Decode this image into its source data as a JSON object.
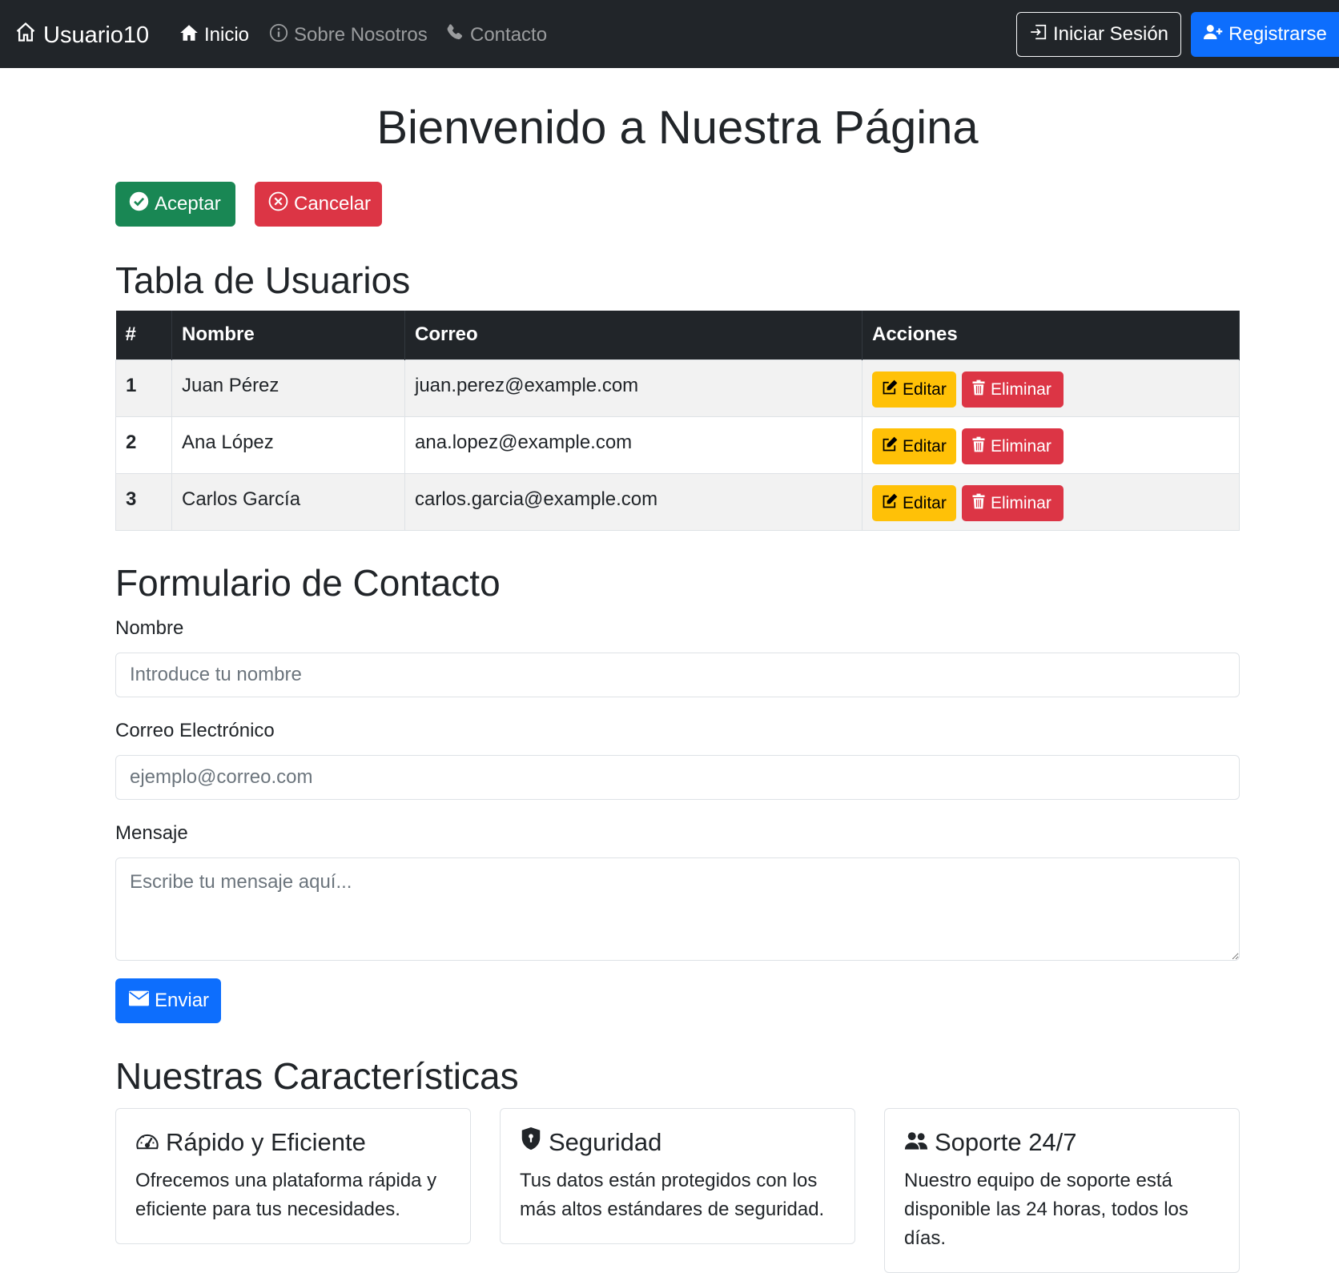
{
  "navbar": {
    "brand": "Usuario10",
    "links": [
      {
        "label": "Inicio",
        "icon": "house-fill-icon"
      },
      {
        "label": "Sobre Nosotros",
        "icon": "info-circle-icon"
      },
      {
        "label": "Contacto",
        "icon": "telephone-fill-icon"
      }
    ],
    "login_label": "Iniciar Sesión",
    "register_label": "Registrarse"
  },
  "page": {
    "title": "Bienvenido a Nuestra Página",
    "accept_label": "Aceptar",
    "cancel_label": "Cancelar"
  },
  "users": {
    "title": "Tabla de Usuarios",
    "headers": [
      "#",
      "Nombre",
      "Correo",
      "Acciones"
    ],
    "rows": [
      {
        "id": "1",
        "name": "Juan Pérez",
        "email": "juan.perez@example.com"
      },
      {
        "id": "2",
        "name": "Ana López",
        "email": "ana.lopez@example.com"
      },
      {
        "id": "3",
        "name": "Carlos García",
        "email": "carlos.garcia@example.com"
      }
    ],
    "edit_label": "Editar",
    "delete_label": "Eliminar"
  },
  "form": {
    "title": "Formulario de Contacto",
    "name_label": "Nombre",
    "name_placeholder": "Introduce tu nombre",
    "email_label": "Correo Electrónico",
    "email_placeholder": "ejemplo@correo.com",
    "message_label": "Mensaje",
    "message_placeholder": "Escribe tu mensaje aquí...",
    "send_label": "Enviar"
  },
  "features": {
    "title": "Nuestras Características",
    "cards": [
      {
        "title": "Rápido y Eficiente",
        "icon": "speedometer-icon",
        "text": "Ofrecemos una plataforma rápida y eficiente para tus necesidades."
      },
      {
        "title": "Seguridad",
        "icon": "shield-lock-icon",
        "text": "Tus datos están protegidos con los más altos estándares de seguridad."
      },
      {
        "title": "Soporte 24/7",
        "icon": "people-fill-icon",
        "text": "Nuestro equipo de soporte está disponible las 24 horas, todos los días."
      }
    ]
  },
  "colors": {
    "navbar": "#212529",
    "primary": "#0d6efd",
    "success": "#198754",
    "danger": "#dc3545",
    "warning": "#ffc107"
  }
}
